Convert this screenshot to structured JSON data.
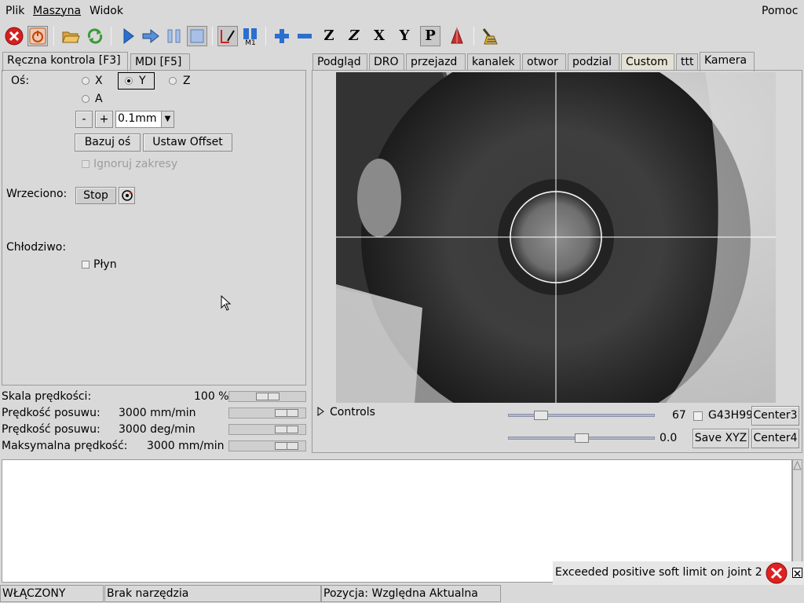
{
  "menu": {
    "plik": "Plik",
    "maszyna": "Maszyna",
    "widok": "Widok",
    "pomoc": "Pomoc"
  },
  "left_tabs": [
    "Ręczna kontrola [F3]",
    "MDI [F5]"
  ],
  "manual": {
    "axis_label": "Oś:",
    "axes": {
      "x": "X",
      "y": "Y",
      "z": "Z",
      "a": "A"
    },
    "selected_axis": "Y",
    "minus": "-",
    "plus": "+",
    "increment": "0.1mm",
    "home_button": "Bazuj oś",
    "offset_button": "Ustaw Offset",
    "ignore_limits": "Ignoruj zakresy",
    "spindle_label": "Wrzeciono:",
    "spindle_stop": "Stop",
    "coolant_label": "Chłodziwo:",
    "flood": "Płyn"
  },
  "overrides": [
    {
      "label": "Skala prędkości:",
      "value": "100 %",
      "level": 0.5
    },
    {
      "label": "Prędkość posuwu:",
      "value": "3000 mm/min",
      "level": 0.86
    },
    {
      "label": "Prędkość posuwu:",
      "value": "3000 deg/min",
      "level": 0.86
    },
    {
      "label": "Maksymalna prędkość:",
      "value": "3000 mm/min",
      "level": 0.86
    }
  ],
  "right_tabs": [
    "Podgląd",
    "DRO",
    "przejazd",
    "kanalek",
    "otwor",
    "podzial",
    "Custom",
    "ttt",
    "Kamera"
  ],
  "active_right_tab": "Kamera",
  "camera_panel": {
    "controls": "Controls",
    "slider1_value": "67",
    "slider1_level": 0.19,
    "slider2_value": "0.0",
    "slider2_level": 0.5,
    "g43_label": "G43H99",
    "center3": "Center3",
    "center4": "Center4",
    "save_xyz": "Save XYZ"
  },
  "notification": {
    "text": "Exceeded positive soft limit on joint 2"
  },
  "status": {
    "state": "WŁĄCZONY",
    "tool": "Brak narzędzia",
    "position": "Pozycja: Względna Aktualna"
  },
  "icons": [
    "estop-icon",
    "machine-power-icon",
    "open-file-icon",
    "reload-icon",
    "run-icon",
    "step-icon",
    "pause-icon",
    "stop-icon",
    "block-delete-icon",
    "optional-stop-icon",
    "zoom-in-icon",
    "zoom-out-icon",
    "view-z-icon",
    "view-z2-icon",
    "view-x-icon",
    "view-y-icon",
    "view-p-icon",
    "rotate-view-icon",
    "clear-plot-icon"
  ],
  "colors": {
    "background": "#d9d9d9",
    "estop_red": "#d42020",
    "toolbar_blue": "#2a6fcf",
    "error_red": "#e02020"
  }
}
